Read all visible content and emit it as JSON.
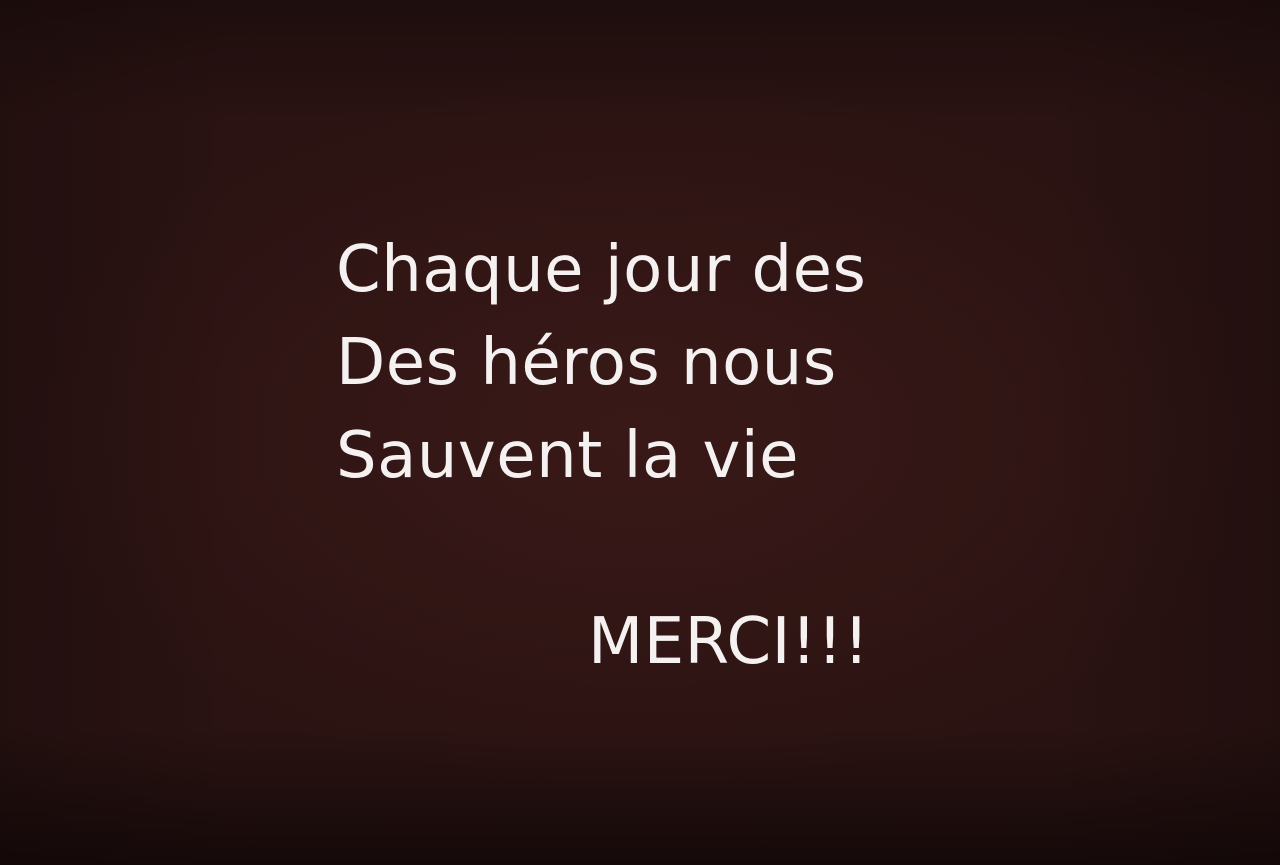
{
  "message": {
    "lines": [
      "Chaque jour des",
      "Des héros nous",
      "Sauvent la vie"
    ]
  },
  "thanks": "MERCI!!!",
  "colors": {
    "background": "#2a1312",
    "text": "#f4f1f0"
  }
}
